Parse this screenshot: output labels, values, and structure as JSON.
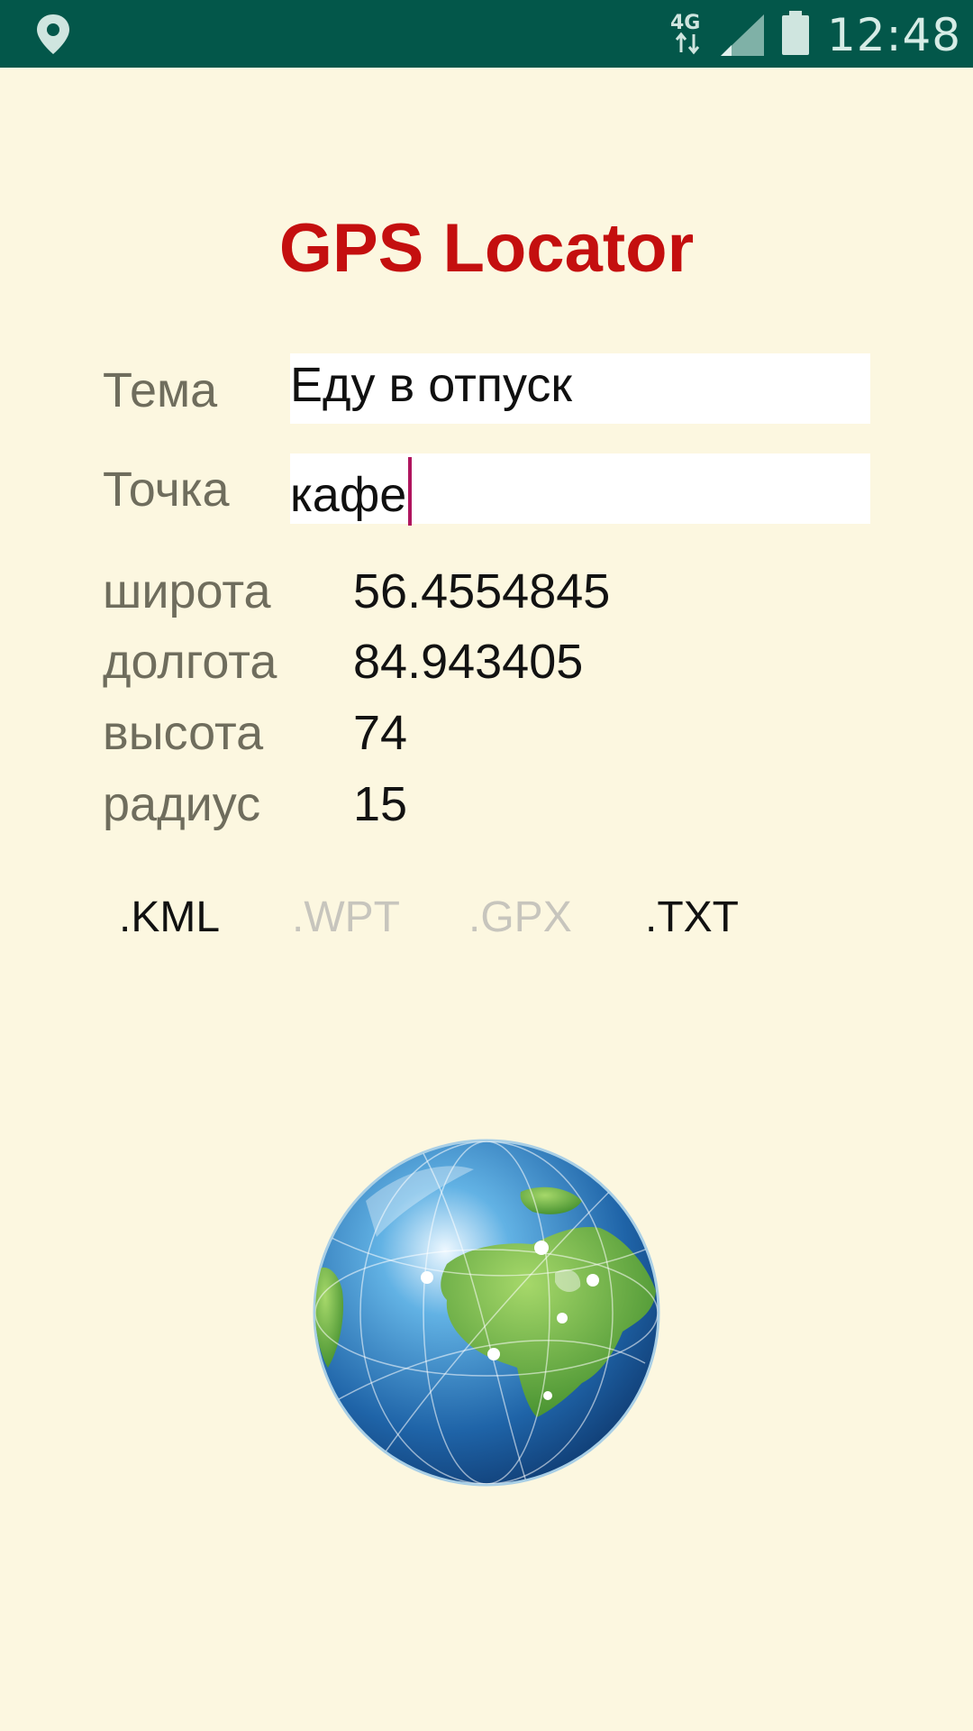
{
  "status_bar": {
    "time": "12:48",
    "network": "4G",
    "icons": [
      "location-pin-icon",
      "network-4g-icon",
      "signal-icon",
      "battery-icon"
    ]
  },
  "app": {
    "title": "GPS Locator",
    "title_color": "#c40f0f",
    "background": "#fcf7e0"
  },
  "form": {
    "theme_label": "Тема",
    "theme_value": "Еду в отпуск",
    "point_label": "Точка",
    "point_value": "кафе"
  },
  "coords": {
    "latitude_label": "широта",
    "latitude_value": "56.4554845",
    "longitude_label": "долгота",
    "longitude_value": "84.943405",
    "altitude_label": "высота",
    "altitude_value": "74",
    "radius_label": "радиус",
    "radius_value": "15"
  },
  "formats": [
    {
      "label": ".KML",
      "enabled": true
    },
    {
      "label": ".WPT",
      "enabled": false
    },
    {
      "label": ".GPX",
      "enabled": false
    },
    {
      "label": ".TXT",
      "enabled": true
    }
  ],
  "image": {
    "icon": "globe-icon"
  }
}
